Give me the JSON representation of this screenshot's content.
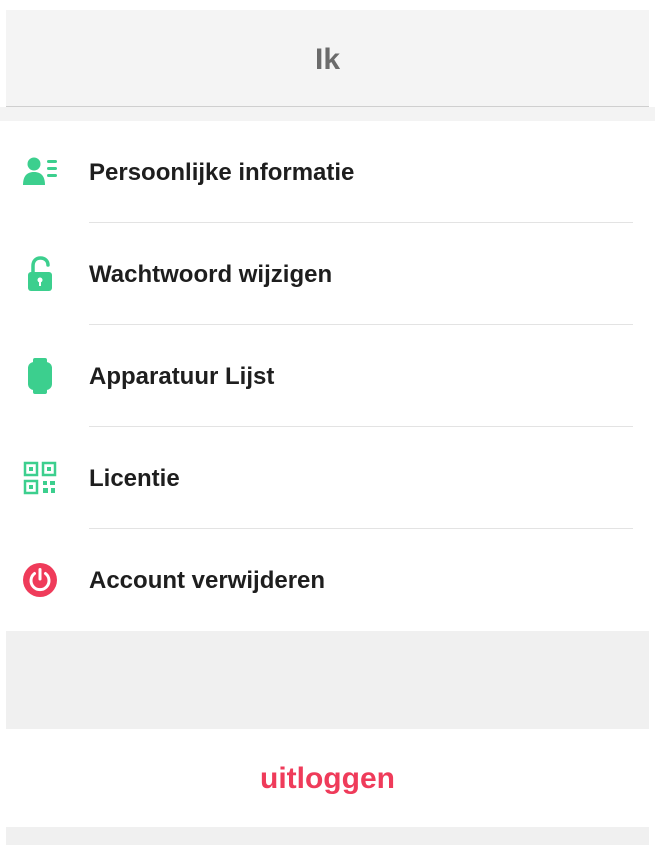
{
  "header": {
    "title": "Ik"
  },
  "menu": {
    "items": [
      {
        "label": "Persoonlijke informatie",
        "icon": "contact-card-icon"
      },
      {
        "label": "Wachtwoord wijzigen",
        "icon": "lock-icon"
      },
      {
        "label": "Apparatuur Lijst",
        "icon": "smartwatch-icon"
      },
      {
        "label": "Licentie",
        "icon": "qr-code-icon"
      },
      {
        "label": "Account verwijderen",
        "icon": "power-icon"
      }
    ]
  },
  "logout": {
    "label": "uitloggen"
  },
  "colors": {
    "accent": "#3ccf8e",
    "danger": "#ef3b5a",
    "title": "#6b6b6b",
    "background": "#f0f0f0"
  }
}
